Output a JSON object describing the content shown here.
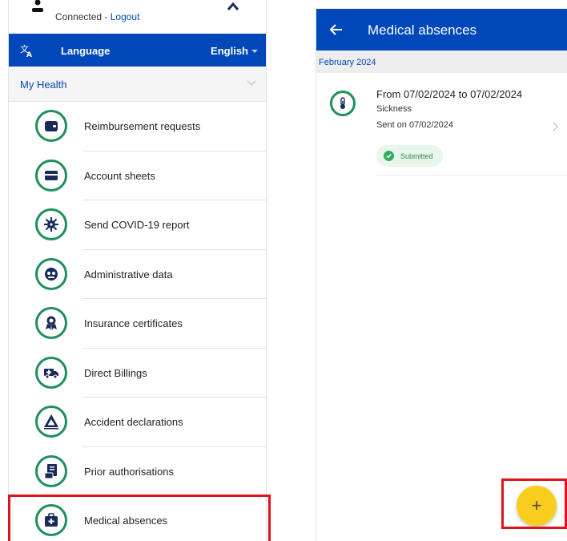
{
  "left_panel": {
    "user": {
      "connected_text": "Connected - ",
      "logout_link": "Logout"
    },
    "language": {
      "label": "Language",
      "selected": "English"
    },
    "section": {
      "title": "My Health"
    },
    "menu_items": [
      {
        "label": "Reimbursement requests",
        "icon": "wallet-icon"
      },
      {
        "label": "Account sheets",
        "icon": "card-icon"
      },
      {
        "label": "Send COVID-19 report",
        "icon": "virus-icon"
      },
      {
        "label": "Administrative data",
        "icon": "id-face-icon"
      },
      {
        "label": "Insurance certificates",
        "icon": "award-icon"
      },
      {
        "label": "Direct Billings",
        "icon": "ambulance-icon"
      },
      {
        "label": "Accident declarations",
        "icon": "warning-triangle-icon"
      },
      {
        "label": "Prior authorisations",
        "icon": "document-icon"
      },
      {
        "label": "Medical absences",
        "icon": "medical-bag-icon"
      }
    ]
  },
  "right_panel": {
    "title": "Medical absences",
    "month": "February 2024",
    "absence": {
      "title": "From 07/02/2024 to 07/02/2024",
      "type": "Sickness",
      "sent": "Sent on 07/02/2024",
      "status": "Submitted"
    },
    "fab_label": "+"
  },
  "colors": {
    "primary": "#0047ba",
    "icon_ring": "#1f8f5e",
    "fab": "#f8cd1e",
    "highlight": "#e0121b",
    "status_green": "#35ad5f"
  }
}
